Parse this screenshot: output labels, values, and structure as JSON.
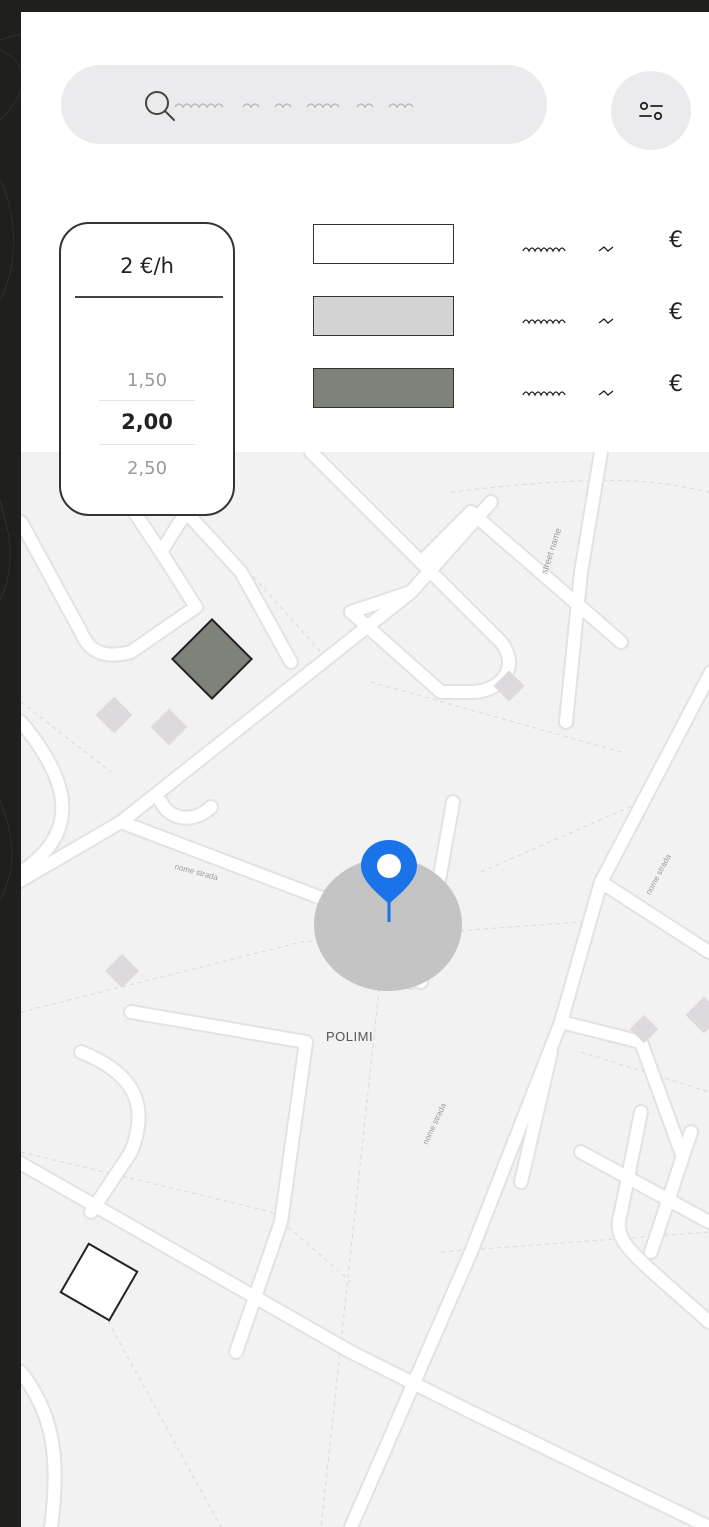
{
  "search": {
    "placeholder_icon": "search-icon"
  },
  "filter": {
    "icon": "sliders-icon"
  },
  "price_picker": {
    "current": "2 €/h",
    "options": [
      "1,50",
      "2,00",
      "2,50"
    ],
    "selected": "2,00"
  },
  "legend": [
    {
      "color": "#ffffff",
      "currency": "€"
    },
    {
      "color": "#d3d3d3",
      "currency": "€"
    },
    {
      "color": "#7e827b",
      "currency": "€"
    }
  ],
  "map": {
    "street_labels": [
      "street name",
      "nome strada",
      "nome strada",
      "nome strada"
    ],
    "place_label": "POLIMI",
    "pin_color": "#1a73e8"
  }
}
